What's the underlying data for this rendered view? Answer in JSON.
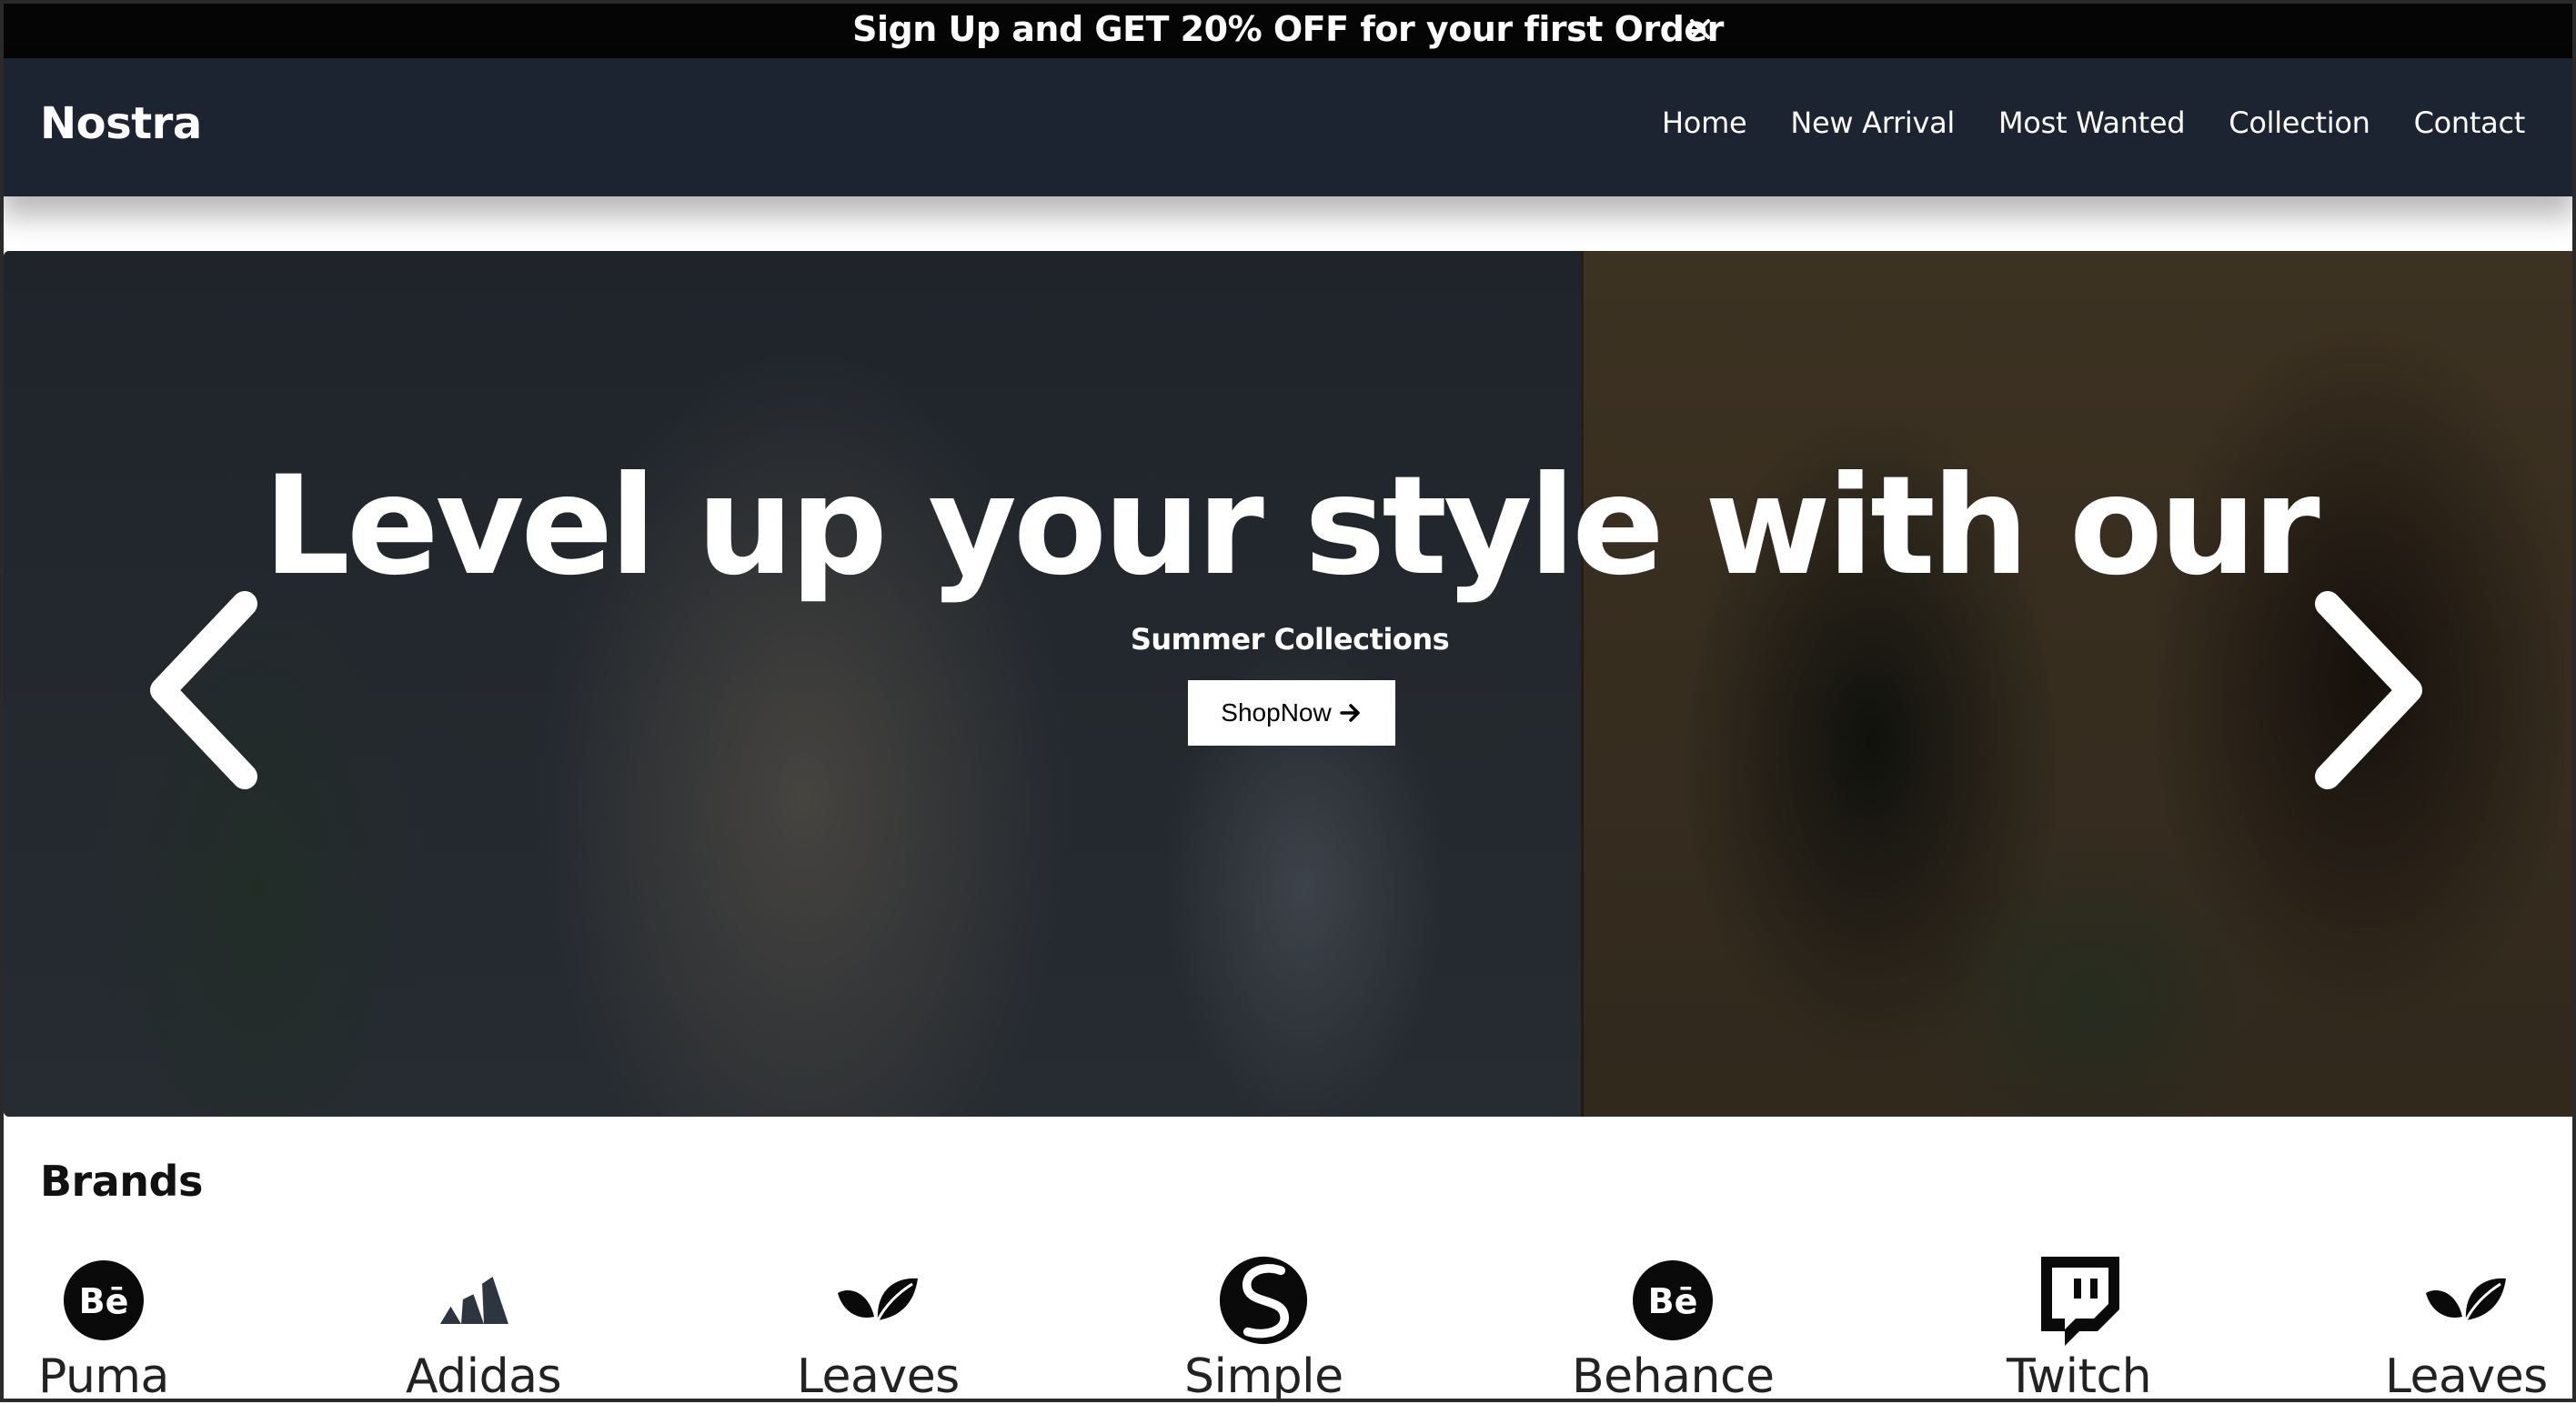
{
  "announcement": {
    "text": "Sign Up and GET 20% OFF for your first Order",
    "close_glyph": "✕"
  },
  "navbar": {
    "brand": "Nostra",
    "links": [
      "Home",
      "New Arrival",
      "Most Wanted",
      "Collection",
      "Contact"
    ]
  },
  "hero": {
    "title": "Level up your style with our",
    "subtitle": "Summer Collections",
    "cta_label": "ShopNow",
    "cta_icon": "arrow-right-icon"
  },
  "brands": {
    "heading": "Brands",
    "items": [
      {
        "label": "Puma",
        "icon": "behance-icon"
      },
      {
        "label": "Adidas",
        "icon": "adidas-icon"
      },
      {
        "label": "Leaves",
        "icon": "leaves-icon"
      },
      {
        "label": "Simple",
        "icon": "simple-icon"
      },
      {
        "label": "Behance",
        "icon": "behance-icon"
      },
      {
        "label": "Twitch",
        "icon": "twitch-icon"
      },
      {
        "label": "Leaves",
        "icon": "leaves-icon"
      }
    ]
  },
  "colors": {
    "announcement_bg": "#050505",
    "navbar_bg": "#1b2430",
    "text_light": "#ffffff",
    "text_dark": "#111111"
  }
}
